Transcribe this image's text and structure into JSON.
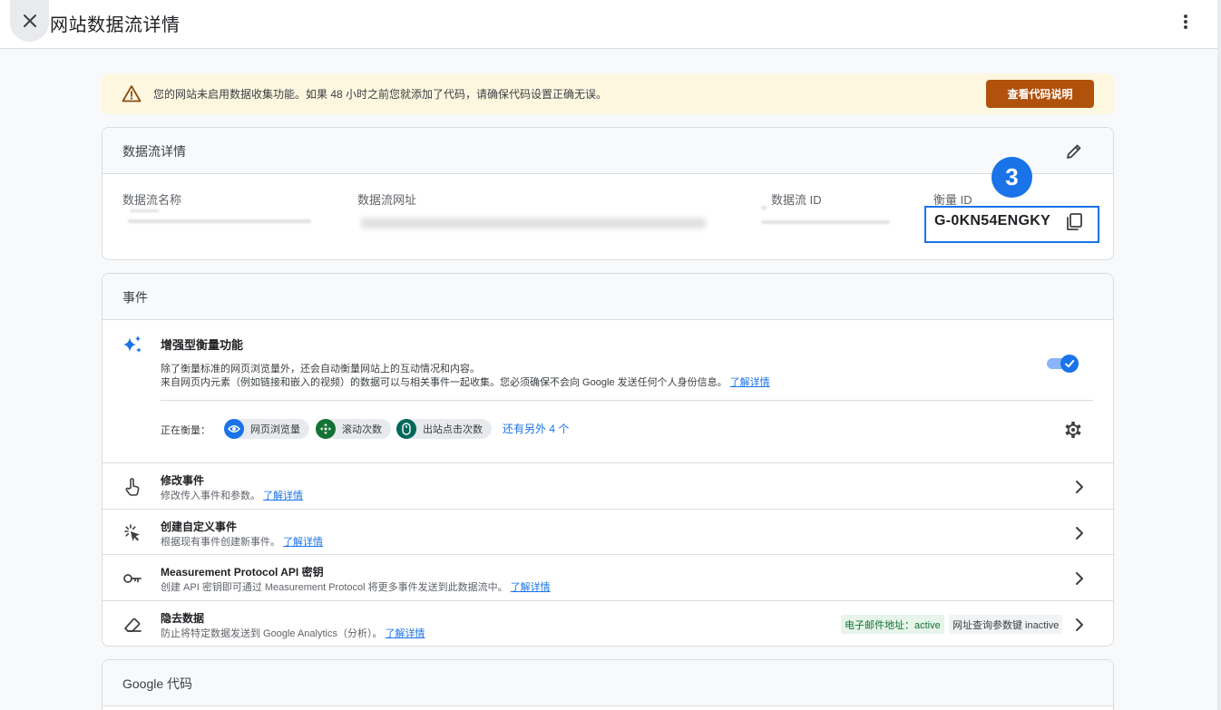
{
  "header": {
    "title": "网站数据流详情"
  },
  "banner": {
    "message": "您的网站未启用数据收集功能。如果 48 小时之前您就添加了代码，请确保代码设置正确无误。",
    "button_label": "查看代码说明"
  },
  "stream_details": {
    "title": "数据流详情",
    "fields": {
      "name_label": "数据流名称",
      "url_label": "数据流网址",
      "id_label": "数据流 ID",
      "measurement_id_label": "衡量 ID",
      "measurement_id_value": "G-0KN54ENGKY"
    },
    "step_number": "3"
  },
  "events": {
    "title": "事件",
    "enhanced": {
      "title": "增强型衡量功能",
      "desc_line1": "除了衡量标准的网页浏览量外，还会自动衡量网站上的互动情况和内容。",
      "desc_line2": "来自网页内元素（例如链接和嵌入的视频）的数据可以与相关事件一起收集。您必须确保不会向 Google 发送任何个人身份信息。",
      "learn_more": "了解详情",
      "toggle_on": true,
      "measuring_label": "正在衡量：",
      "chips": [
        "网页浏览量",
        "滚动次数",
        "出站点击次数"
      ],
      "more_link": "还有另外 4 个"
    },
    "rows": [
      {
        "title": "修改事件",
        "desc": "修改传入事件和参数。",
        "link": "了解详情"
      },
      {
        "title": "创建自定义事件",
        "desc": "根据现有事件创建新事件。",
        "link": "了解详情"
      },
      {
        "title": "Measurement Protocol API 密钥",
        "desc": "创建 API 密钥即可通过 Measurement Protocol 将更多事件发送到此数据流中。",
        "link": "了解详情"
      },
      {
        "title": "隐去数据",
        "desc": "防止将特定数据发送到 Google Analytics（分析）。",
        "link": "了解详情",
        "tag_email": "电子邮件地址：active",
        "tag_query": "网址查询参数键 inactive"
      }
    ]
  },
  "google_tag": {
    "title": "Google 代码"
  },
  "colors": {
    "accent": "#1a73e8",
    "banner_button": "#b0510c",
    "banner_bg": "#fef7e0"
  }
}
